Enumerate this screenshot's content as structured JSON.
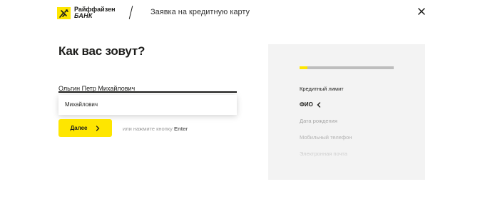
{
  "header": {
    "logo_line1": "Райффайзен",
    "logo_line2": "БАНК",
    "title": "Заявка на кредитную карту",
    "close_icon": "close-icon"
  },
  "form": {
    "heading": "Как вас зовут?",
    "name_value": "Ольгин Петр Михайлович",
    "suggestion": "Михайлович",
    "next_label": "Далее",
    "hint_prefix": "или нажмите кнопку",
    "hint_key": "Enter"
  },
  "steps": {
    "progress": 0.08,
    "items": [
      {
        "label": "Кредитный лимит",
        "state": "done"
      },
      {
        "label": "ФИО",
        "state": "active"
      },
      {
        "label": "Дата рождения",
        "state": "pending"
      },
      {
        "label": "Мобильный телефон",
        "state": "pending"
      },
      {
        "label": "Электронная почта",
        "state": "pending"
      }
    ]
  },
  "colors": {
    "accent": "#fee600",
    "panel_bg": "#f3f3f3",
    "text": "#1d1d1b"
  }
}
